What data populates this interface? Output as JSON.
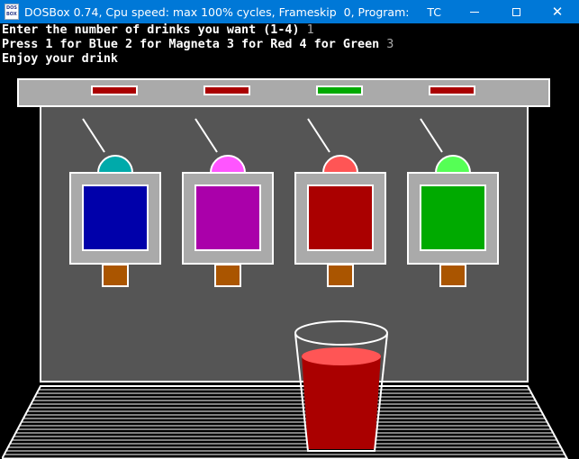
{
  "window": {
    "title": "DOSBox 0.74, Cpu speed: max 100% cycles, Frameskip  0, Program:     TC",
    "icon": "dosbox-app-icon",
    "controls": [
      "minimize-icon",
      "maximize-icon",
      "close-icon"
    ]
  },
  "console": {
    "line1_prompt": "Enter the number of drinks you want (1-4) ",
    "line1_answer": "1",
    "line2_prompt": "Press 1 for Blue 2 for Magneta 3 for Red 4 for Green ",
    "line2_answer": "3",
    "line3": "Enjoy your drink"
  },
  "machine": {
    "indicators": [
      {
        "name": "blue",
        "color": "#aa0000"
      },
      {
        "name": "magenta",
        "color": "#aa0000"
      },
      {
        "name": "red",
        "color": "#00aa00"
      },
      {
        "name": "green",
        "color": "#aa0000"
      }
    ],
    "dispensers": [
      {
        "name": "blue",
        "knob": "#00aaaa",
        "drink": "#0000aa"
      },
      {
        "name": "magenta",
        "knob": "#ff55ff",
        "drink": "#aa00aa"
      },
      {
        "name": "red",
        "knob": "#ff5555",
        "drink": "#aa0000"
      },
      {
        "name": "green",
        "knob": "#55ff55",
        "drink": "#00aa00"
      }
    ],
    "glass_fill": "#aa0000",
    "glass_surface": "#ff5555",
    "body_color": "#555555",
    "frame_color": "#aaaaaa",
    "nozzle_color": "#aa5500"
  }
}
